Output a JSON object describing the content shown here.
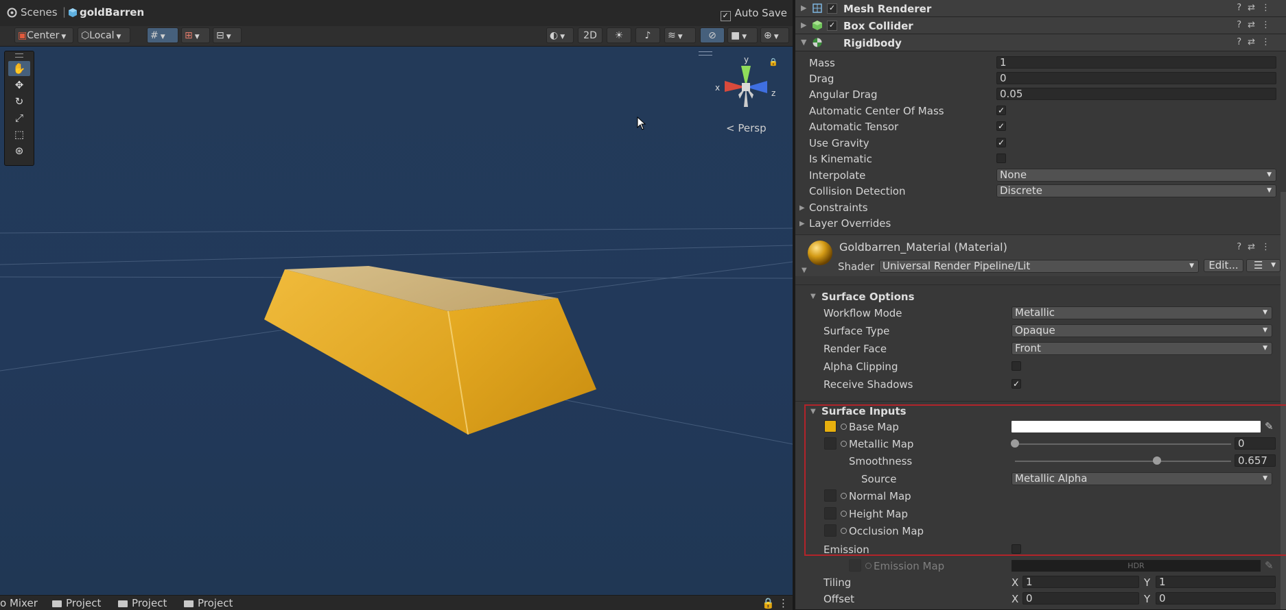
{
  "scene_header": {
    "breadcrumb_root": "Scenes",
    "breadcrumb_object": "goldBarren",
    "autosave_label": "Auto Save",
    "autosave_checked": true
  },
  "scene_toolbar": {
    "pivot_mode": "Center",
    "pivot_rotation": "Local",
    "view_2d_label": "2D"
  },
  "viewport": {
    "projection_label": "Persp",
    "gizmo_axes": {
      "x": "x",
      "y": "y",
      "z": "z"
    },
    "object_color": "#e6ac26",
    "background_color": "#233a59"
  },
  "bottom_tabs": [
    "o Mixer",
    "Project",
    "Project",
    "Project"
  ],
  "inspector": {
    "mesh_renderer": {
      "title": "Mesh Renderer",
      "enabled": true
    },
    "box_collider": {
      "title": "Box Collider",
      "enabled": true
    },
    "rigidbody": {
      "title": "Rigidbody",
      "mass_label": "Mass",
      "mass": "1",
      "drag_label": "Drag",
      "drag": "0",
      "angular_drag_label": "Angular Drag",
      "angular_drag": "0.05",
      "auto_com_label": "Automatic Center Of Mass",
      "auto_com": true,
      "auto_tensor_label": "Automatic Tensor",
      "auto_tensor": true,
      "use_gravity_label": "Use Gravity",
      "use_gravity": true,
      "is_kinematic_label": "Is Kinematic",
      "is_kinematic": false,
      "interpolate_label": "Interpolate",
      "interpolate": "None",
      "collision_label": "Collision Detection",
      "collision": "Discrete",
      "constraints_label": "Constraints",
      "layer_overrides_label": "Layer Overrides"
    },
    "material": {
      "name": "Goldbarren_Material (Material)",
      "shader_label": "Shader",
      "shader_value": "Universal Render Pipeline/Lit",
      "edit_label": "Edit..."
    },
    "surface_options": {
      "title": "Surface Options",
      "workflow_label": "Workflow Mode",
      "workflow": "Metallic",
      "surface_type_label": "Surface Type",
      "surface_type": "Opaque",
      "render_face_label": "Render Face",
      "render_face": "Front",
      "alpha_clip_label": "Alpha Clipping",
      "alpha_clip": false,
      "receive_shadows_label": "Receive Shadows",
      "receive_shadows": true
    },
    "surface_inputs": {
      "title": "Surface Inputs",
      "base_map_label": "Base Map",
      "base_map_color": "#e8b00e",
      "metallic_map_label": "Metallic Map",
      "metallic_value": "0",
      "metallic_fraction": 0,
      "smoothness_label": "Smoothness",
      "smoothness_value": "0.657",
      "smoothness_fraction": 0.657,
      "source_label": "Source",
      "source_value": "Metallic Alpha",
      "normal_map_label": "Normal Map",
      "height_map_label": "Height Map",
      "occlusion_map_label": "Occlusion Map",
      "emission_label": "Emission",
      "emission": false,
      "emission_map_label": "Emission Map",
      "hdr_label": "HDR",
      "tiling_label": "Tiling",
      "tiling_x": "1",
      "tiling_y": "1",
      "offset_label": "Offset",
      "offset_x": "0",
      "offset_y": "0",
      "x_label": "X",
      "y_label": "Y"
    }
  }
}
